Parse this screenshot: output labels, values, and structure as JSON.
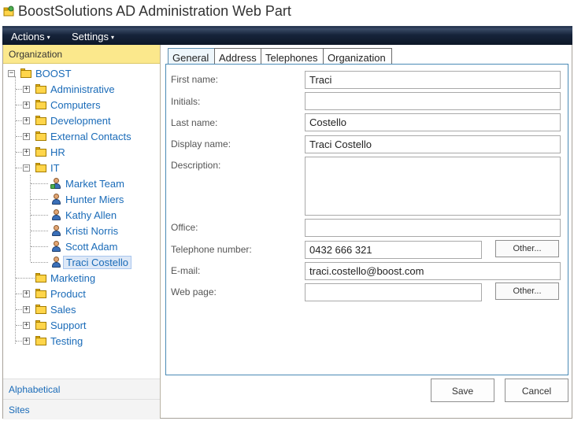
{
  "window": {
    "title": "BoostSolutions AD Administration Web Part",
    "icon": "ad-webpart-icon"
  },
  "toolbar": {
    "menus": [
      {
        "label": "Actions",
        "caret": "▾"
      },
      {
        "label": "Settings",
        "caret": "▾"
      }
    ]
  },
  "left_panel": {
    "header": "Organization",
    "root": {
      "label": "BOOST",
      "expander": "−"
    },
    "items": [
      {
        "label": "Administrative",
        "type": "ou",
        "expander": "+"
      },
      {
        "label": "Computers",
        "type": "ou",
        "expander": "+"
      },
      {
        "label": "Development",
        "type": "ou",
        "expander": "+"
      },
      {
        "label": "External Contacts",
        "type": "ou",
        "expander": "+"
      },
      {
        "label": "HR",
        "type": "ou",
        "expander": "+"
      },
      {
        "label": "IT",
        "type": "ou",
        "expander": "−"
      },
      {
        "label": "Market Team",
        "type": "group"
      },
      {
        "label": "Hunter Miers",
        "type": "user"
      },
      {
        "label": "Kathy Allen",
        "type": "user"
      },
      {
        "label": "Kristi Norris",
        "type": "user"
      },
      {
        "label": "Scott Adam",
        "type": "user"
      },
      {
        "label": "Traci Costello",
        "type": "user",
        "selected": true
      },
      {
        "label": "Marketing",
        "type": "ou",
        "expander": ""
      },
      {
        "label": "Product",
        "type": "ou",
        "expander": "+"
      },
      {
        "label": "Sales",
        "type": "ou",
        "expander": "+"
      },
      {
        "label": "Support",
        "type": "ou",
        "expander": "+"
      },
      {
        "label": "Testing",
        "type": "ou",
        "expander": "+"
      }
    ],
    "footer": [
      {
        "label": "Alphabetical"
      },
      {
        "label": "Sites"
      }
    ]
  },
  "tabs": [
    {
      "label": "General",
      "active": true
    },
    {
      "label": "Address"
    },
    {
      "label": "Telephones"
    },
    {
      "label": "Organization"
    }
  ],
  "form": {
    "first_name": {
      "label": "First name:",
      "value": "Traci"
    },
    "initials": {
      "label": "Initials:",
      "value": ""
    },
    "last_name": {
      "label": "Last name:",
      "value": "Costello"
    },
    "display_name": {
      "label": "Display name:",
      "value": "Traci Costello"
    },
    "description": {
      "label": "Description:",
      "value": ""
    },
    "office": {
      "label": "Office:",
      "value": ""
    },
    "telephone": {
      "label": "Telephone number:",
      "value": "0432 666 321",
      "other_label": "Other..."
    },
    "email": {
      "label": "E-mail:",
      "value": "traci.costello@boost.com"
    },
    "web_page": {
      "label": "Web page:",
      "value": "",
      "other_label": "Other..."
    }
  },
  "buttons": {
    "save": "Save",
    "cancel": "Cancel"
  }
}
